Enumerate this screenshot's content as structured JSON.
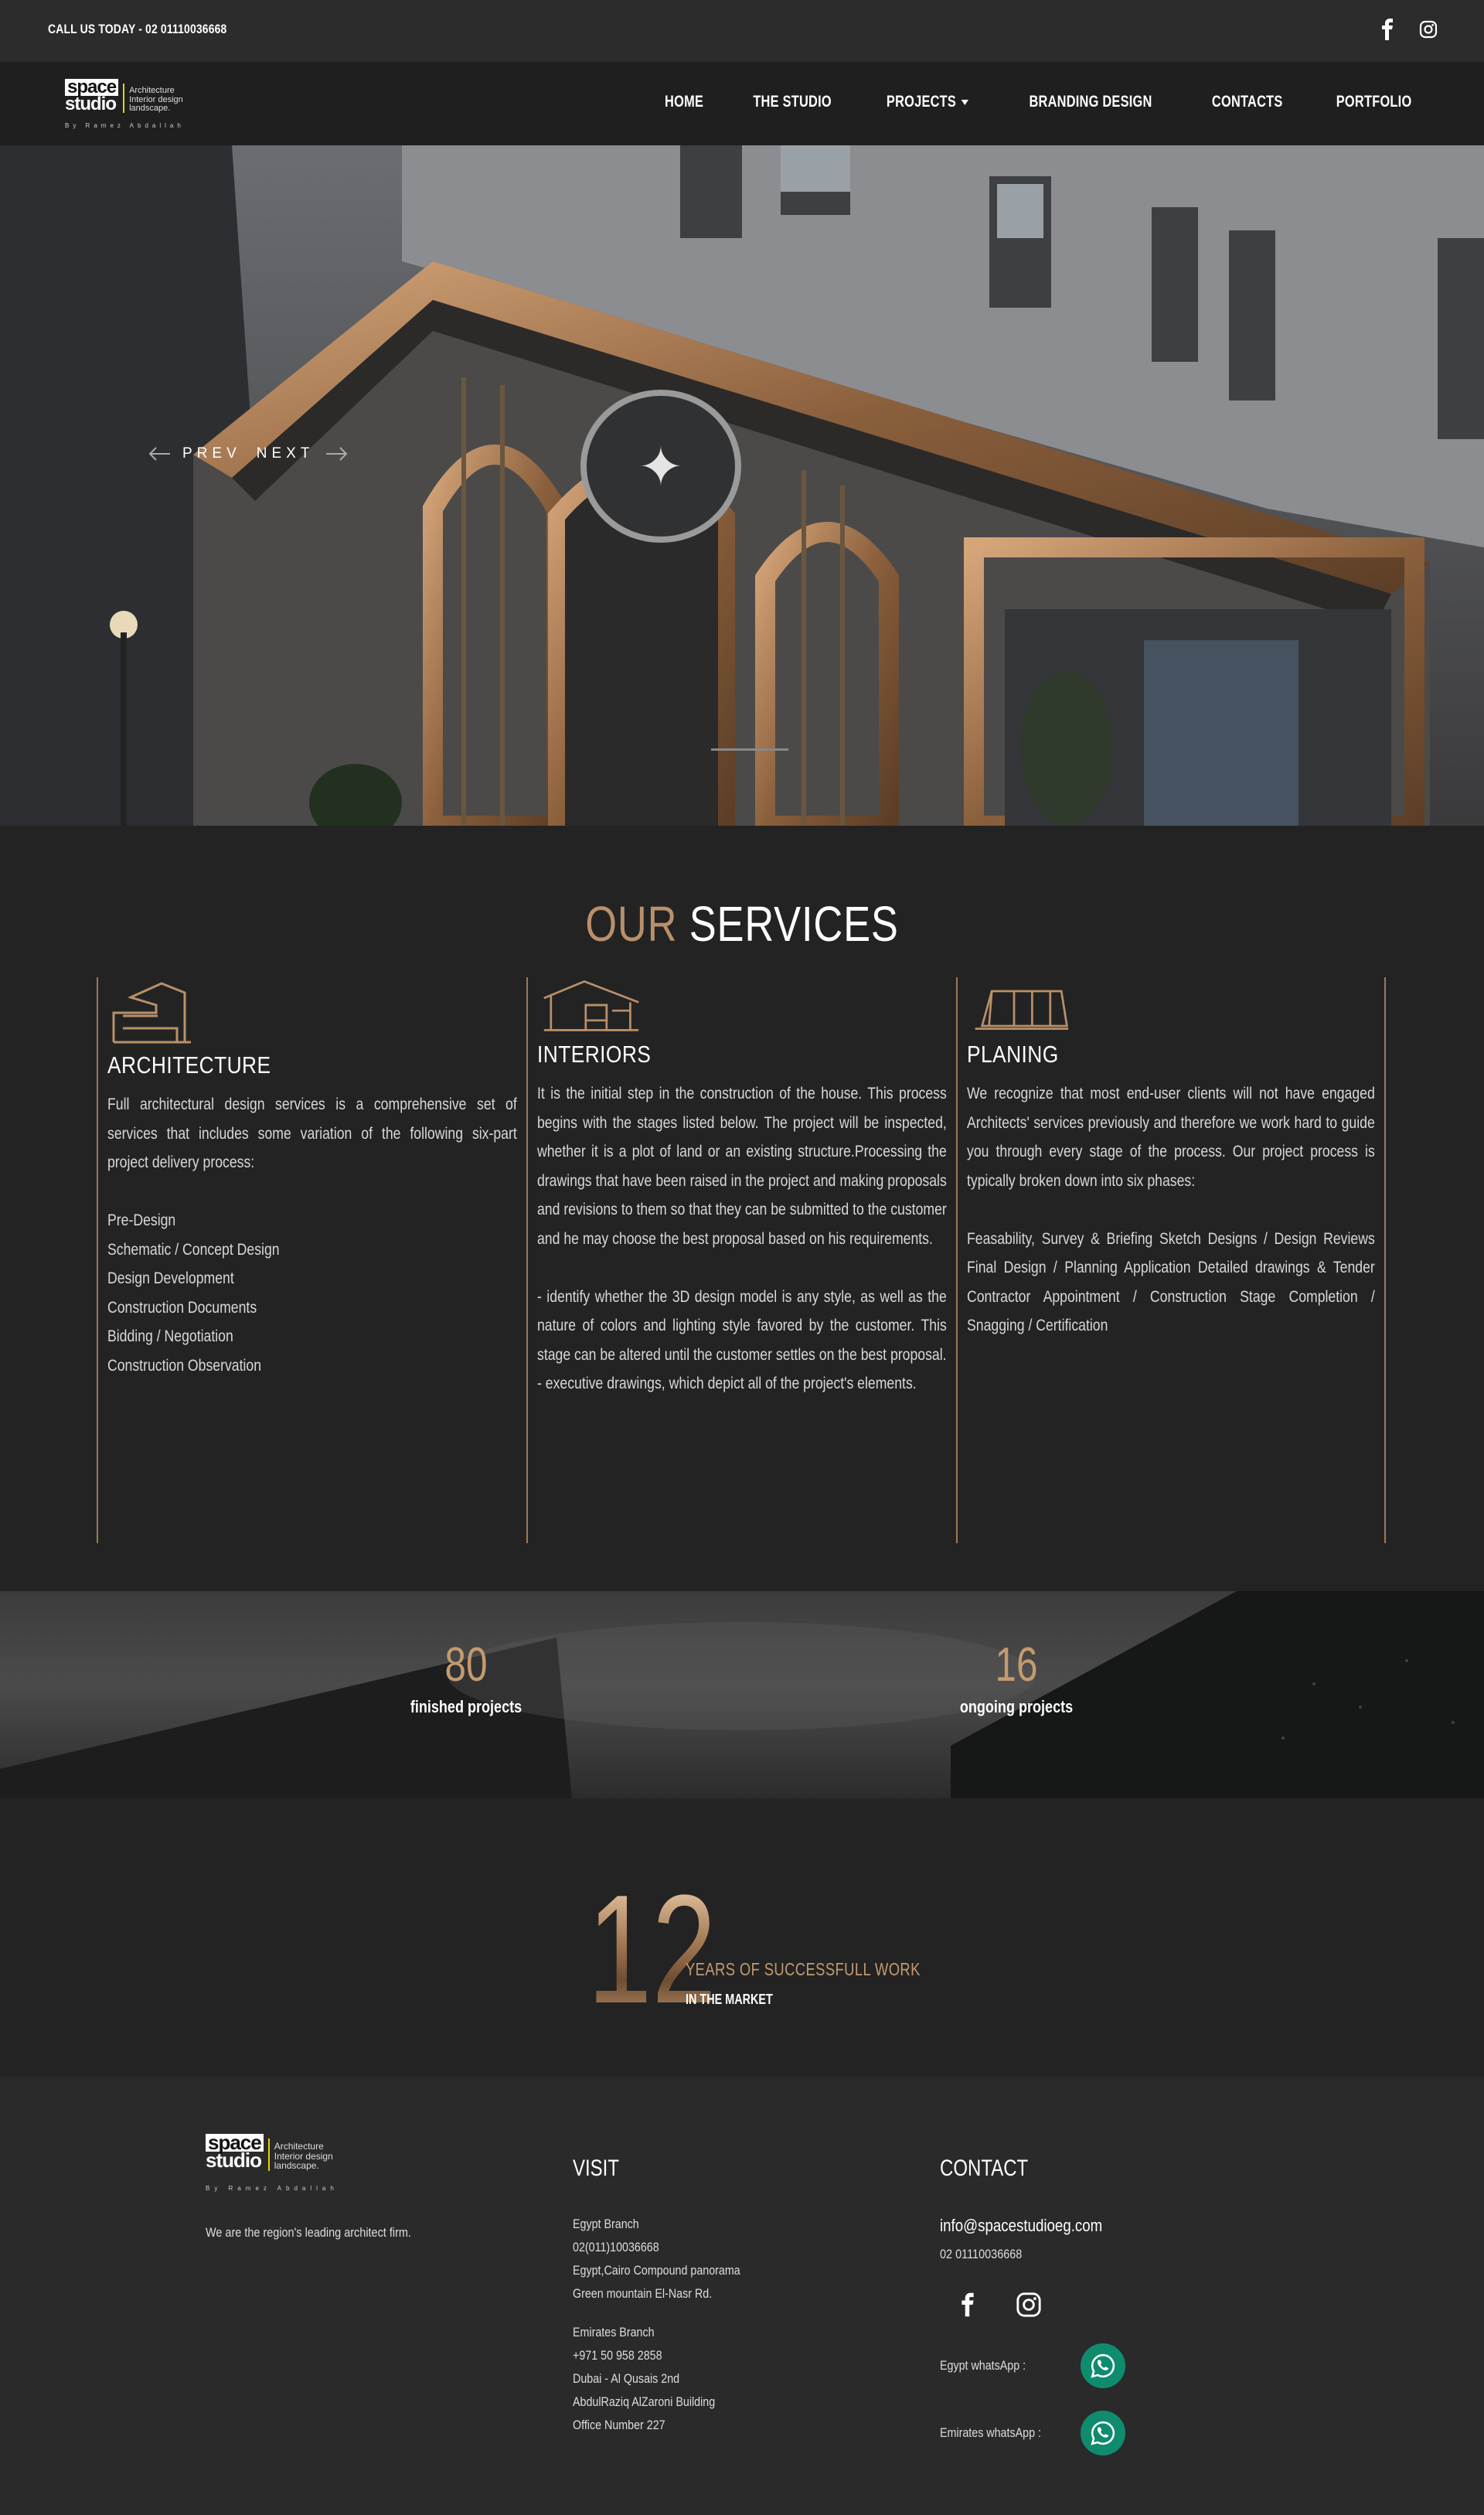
{
  "topbar": {
    "call_text": "CALL US TODAY - 02 01110036668",
    "social": [
      "facebook-icon",
      "instagram-icon"
    ]
  },
  "brand": {
    "wordmark_line1": "space",
    "wordmark_line2": "studio",
    "tagline_1": "Architecture",
    "tagline_2": "Interior design",
    "tagline_3": "landscape.",
    "by_line": "By Ramez Abdallah"
  },
  "nav": {
    "items": [
      "HOME",
      "THE STUDIO",
      "PROJECTS",
      "BRANDING DESIGN",
      "CONTACTS",
      "PORTFOLIO"
    ]
  },
  "hero": {
    "prev_label": "PREV",
    "next_label": "NEXT"
  },
  "services": {
    "title_accent": "OUR",
    "title_main": "SERVICES",
    "items": [
      {
        "icon": "architecture-icon",
        "title": "ARCHITECTURE",
        "intro": "Full architectural design services is a comprehensive set of services that includes some variation of the following six-part project delivery process:",
        "list": [
          "Pre-Design",
          "Schematic / Concept Design",
          "Design Development",
          "Construction Documents",
          "Bidding / Negotiation",
          "Construction Observation"
        ]
      },
      {
        "icon": "interiors-icon",
        "title": "INTERIORS",
        "intro": "It is the initial step in the construction of the house. This process begins with the stages listed below. The project will be inspected, whether it is a plot of land or an existing structure.Processing the drawings that have been raised in the project and making proposals and revisions to them so that they can be submitted to the customer and he may choose the best proposal based on his requirements.",
        "extra_1": "- identify whether the 3D design model is any style, as well as the nature of colors and lighting style favored by the customer. This stage can be altered until the customer settles on the best proposal.",
        "extra_2": "- executive drawings, which depict all of the project's elements."
      },
      {
        "icon": "planing-icon",
        "title": "PLANING",
        "intro": "We recognize that most end-user clients will not have engaged Architects' services previously and therefore we work hard to guide you through every stage of the process. Our project process is typically broken down into six phases:",
        "phases": "Feasability, Survey & Briefing Sketch Designs / Design Reviews Final Design / Planning Application Detailed drawings & Tender Contractor Appointment / Construction Stage Completion / Snagging / Certification"
      }
    ]
  },
  "stats": [
    {
      "value": "80",
      "label": "finished projects"
    },
    {
      "value": "16",
      "label": "ongoing projects"
    }
  ],
  "years": {
    "value": "12",
    "line1": "YEARS OF SUCCESSFULL WORK",
    "line2": "IN THE MARKET"
  },
  "footer": {
    "about": "We are the region's leading architect firm.",
    "visit_title": "VISIT",
    "egypt_branch": [
      "Egypt Branch",
      "02(011)10036668",
      "Egypt,Cairo Compound panorama",
      "Green mountain El-Nasr Rd."
    ],
    "emirates_branch": [
      "Emirates Branch",
      "+971 50 958 2858",
      "Dubai - Al Qusais 2nd",
      "AbdulRaziq AlZaroni Building",
      "Office Number 227"
    ],
    "contact_title": "CONTACT",
    "email": "info@spacestudioeg.com",
    "phone": "02 01110036668",
    "whatsapp_egypt_label": "Egypt whatsApp :",
    "whatsapp_emirates_label": "Emirates whatsApp :"
  },
  "colors": {
    "accent": "#b8906a",
    "background": "#232323",
    "whatsapp": "#0f8c6e"
  }
}
